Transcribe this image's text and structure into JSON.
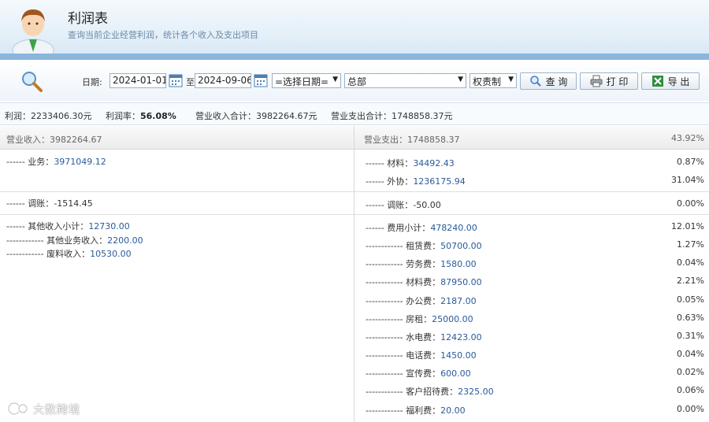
{
  "header": {
    "title": "利润表",
    "subtitle": "查询当前企业经营利润，统计各个收入及支出项目"
  },
  "toolbar": {
    "date_label": "日期:",
    "start_date": "2024-01-01",
    "to_label": "至",
    "end_date": "2024-09-06",
    "date_select": "=选择日期=",
    "dept_select": "总部",
    "system_select": "权责制",
    "query_label": "查 询",
    "print_label": "打 印",
    "export_label": "导 出"
  },
  "summary": {
    "profit_label": "利润：",
    "profit_value": "2233406.30元",
    "margin_label": "利润率：",
    "margin_value": "56.08%",
    "income_label": "营业收入合计：",
    "income_value": "3982264.67元",
    "expense_label": "营业支出合计：",
    "expense_value": "1748858.37元"
  },
  "income": {
    "header_label": "营业收入：",
    "header_value": "3982264.67",
    "business": {
      "label": "------ 业务：",
      "value": "3971049.12"
    },
    "adjust": {
      "label": "------ 调账：",
      "value": "-1514.45"
    },
    "other_subtotal": {
      "label": "------ 其他收入小计：",
      "value": "12730.00"
    },
    "other_business": {
      "label": "------------ 其他业务收入：",
      "value": "2200.00"
    },
    "scrap": {
      "label": "------------ 废料收入：",
      "value": "10530.00"
    }
  },
  "expense": {
    "header_label": "营业支出：",
    "header_value": "1748858.37",
    "header_pct": "43.92%",
    "rows": [
      {
        "label": "------ 材料：",
        "value": "34492.43",
        "pct": "0.87%"
      },
      {
        "label": "------ 外协：",
        "value": "1236175.94",
        "pct": "31.04%"
      },
      {
        "label": "------ 调账：",
        "value": "-50.00",
        "pct": "0.00%"
      },
      {
        "label": "------ 费用小计：",
        "value": "478240.00",
        "pct": "12.01%"
      },
      {
        "label": "------------ 租赁费：",
        "value": "50700.00",
        "pct": "1.27%"
      },
      {
        "label": "------------ 劳务费：",
        "value": "1580.00",
        "pct": "0.04%"
      },
      {
        "label": "------------ 材料费：",
        "value": "87950.00",
        "pct": "2.21%"
      },
      {
        "label": "------------ 办公费：",
        "value": "2187.00",
        "pct": "0.05%"
      },
      {
        "label": "------------ 房租：",
        "value": "25000.00",
        "pct": "0.63%"
      },
      {
        "label": "------------ 水电费：",
        "value": "12423.00",
        "pct": "0.31%"
      },
      {
        "label": "------------ 电话费：",
        "value": "1450.00",
        "pct": "0.04%"
      },
      {
        "label": "------------ 宣传费：",
        "value": "600.00",
        "pct": "0.02%"
      },
      {
        "label": "------------ 客户招待费：",
        "value": "2325.00",
        "pct": "0.06%"
      },
      {
        "label": "------------ 福利费：",
        "value": "20.00",
        "pct": "0.00%"
      }
    ]
  },
  "watermark": {
    "text": "大数跨境"
  }
}
